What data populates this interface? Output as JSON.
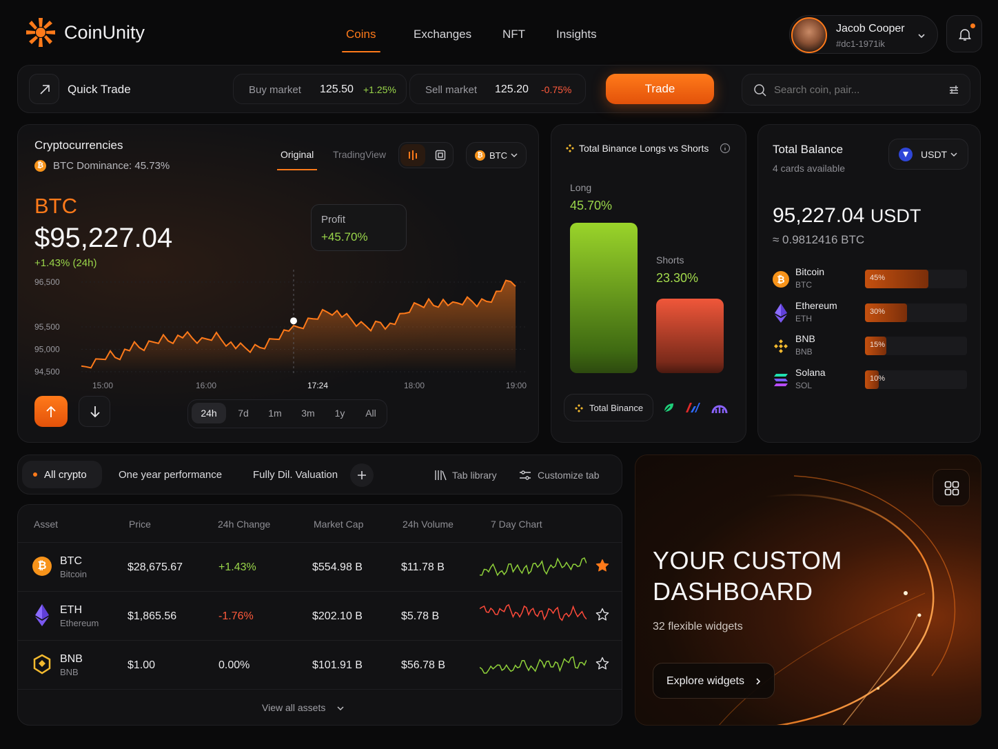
{
  "brand": {
    "name": "CoinUnity",
    "logo_icon": "sunburst-logo-icon"
  },
  "nav": {
    "items": [
      "Coins",
      "Exchanges",
      "NFT",
      "Insights"
    ],
    "active": "Coins"
  },
  "user": {
    "name": "Jacob Cooper",
    "id": "#dc1-1971ik"
  },
  "quick_trade": {
    "label": "Quick Trade",
    "buy_label": "Buy market",
    "buy_price": "125.50",
    "buy_change": "+1.25%",
    "sell_label": "Sell market",
    "sell_price": "125.20",
    "sell_change": "-0.75%",
    "trade_button": "Trade",
    "search_placeholder": "Search coin, pair..."
  },
  "crypto_card": {
    "title": "Cryptocurrencies",
    "dominance": "BTC Dominance: 45.73%",
    "view_tabs": [
      "Original",
      "TradingView"
    ],
    "asset_select": "BTC",
    "symbol": "BTC",
    "price": "$95,227.04",
    "change": "+1.43% (24h)",
    "tooltip_label": "Profit",
    "tooltip_value": "+45.70%",
    "time_ranges": [
      "24h",
      "7d",
      "1m",
      "3m",
      "1y",
      "All"
    ],
    "active_range": "24h"
  },
  "chart_data": {
    "type": "area",
    "title": "",
    "x_ticks": [
      "15:00",
      "16:00",
      "17:24",
      "18:00",
      "19:00"
    ],
    "highlight_x": "17:24",
    "y_ticks": [
      "96,500",
      "95,500",
      "95,000",
      "94,500"
    ],
    "ylim": [
      94500,
      96500
    ],
    "series": [
      {
        "values": [
          94520,
          94590,
          94650,
          94700,
          94780,
          94860,
          94900,
          94840,
          94880,
          94960,
          95010,
          95060,
          95020,
          95040,
          95100,
          95160,
          95220,
          95260,
          95210,
          95240,
          95270,
          95300,
          95280,
          95230,
          95200,
          95170,
          95230,
          95290,
          95310,
          95240,
          95180,
          95120,
          95060,
          95030,
          95010,
          95000,
          95020,
          95040,
          95100,
          95170,
          95250,
          95330,
          95390,
          95450,
          95420,
          95470,
          95530,
          95610,
          95680,
          95760,
          95820,
          95850,
          95870,
          95820,
          95760,
          95690,
          95640,
          95580,
          95530,
          95520,
          95500,
          95560,
          95620,
          95560,
          95540,
          95600,
          95690,
          95780,
          95890,
          95950,
          95990,
          96020,
          96060,
          96000,
          96050,
          96070,
          96020,
          95950,
          96010,
          96060,
          96080,
          96070,
          96040,
          96060,
          96090,
          96160,
          96250,
          96340,
          96430,
          96490,
          96470
        ]
      }
    ],
    "grid": true,
    "color": "#ff7a1a"
  },
  "longs_shorts": {
    "title": "Total Binance Longs vs Shorts",
    "long_label": "Long",
    "long_value": "45.70%",
    "long_fraction": 0.457,
    "short_label": "Shorts",
    "short_value": "23.30%",
    "short_fraction": 0.233,
    "source_label": "Total Binance"
  },
  "balance": {
    "title": "Total Balance",
    "subtitle": "4 cards available",
    "currency": "USDT",
    "amount": "95,227.04",
    "amount_unit": "USDT",
    "btc_equiv": "≈ 0.9812416 BTC",
    "assets": [
      {
        "name": "Bitcoin",
        "ticker": "BTC",
        "percent": "45%",
        "fraction": 0.45
      },
      {
        "name": "Ethereum",
        "ticker": "ETH",
        "percent": "30%",
        "fraction": 0.3
      },
      {
        "name": "BNB",
        "ticker": "BNB",
        "percent": "15%",
        "fraction": 0.15
      },
      {
        "name": "Solana",
        "ticker": "SOL",
        "percent": "10%",
        "fraction": 0.1
      }
    ]
  },
  "tabs_bar": {
    "tabs": [
      "All crypto",
      "One year performance",
      "Fully Dil. Valuation"
    ],
    "active": "All crypto",
    "tab_library": "Tab library",
    "customize": "Customize tab"
  },
  "table": {
    "headers": [
      "Asset",
      "Price",
      "24h Change",
      "Market Cap",
      "24h Volume",
      "7 Day Chart"
    ],
    "rows": [
      {
        "symbol": "BTC",
        "name": "Bitcoin",
        "price": "$28,675.67",
        "change": "+1.43%",
        "cap": "$554.98 B",
        "volume": "$11.78 B",
        "trend": "up",
        "favorite": true
      },
      {
        "symbol": "ETH",
        "name": "Ethereum",
        "price": "$1,865.56",
        "change": "-1.76%",
        "cap": "$202.10 B",
        "volume": "$5.78 B",
        "trend": "down",
        "favorite": false
      },
      {
        "symbol": "BNB",
        "name": "BNB",
        "price": "$1.00",
        "change": "0.00%",
        "cap": "$101.91 B",
        "volume": "$56.78 B",
        "trend": "up",
        "favorite": false
      }
    ],
    "view_all": "View all assets"
  },
  "promo": {
    "headline_1": "YOUR CUSTOM",
    "headline_2": "DASHBOARD",
    "sub": "32 flexible widgets",
    "button": "Explore widgets"
  }
}
